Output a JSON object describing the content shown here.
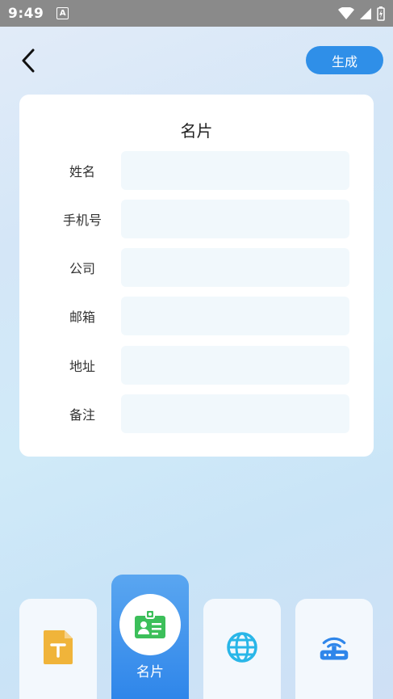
{
  "status": {
    "time": "9:49",
    "a_icon_letter": "A"
  },
  "header": {
    "generate_label": "生成"
  },
  "card": {
    "title": "名片",
    "fields": [
      {
        "label": "姓名",
        "value": "",
        "placeholder": ""
      },
      {
        "label": "手机号",
        "value": "",
        "placeholder": ""
      },
      {
        "label": "公司",
        "value": "",
        "placeholder": ""
      },
      {
        "label": "邮箱",
        "value": "",
        "placeholder": ""
      },
      {
        "label": "地址",
        "value": "",
        "placeholder": ""
      },
      {
        "label": "备注",
        "value": "",
        "placeholder": ""
      }
    ]
  },
  "tabs": [
    {
      "icon": "text-file-icon",
      "label": ""
    },
    {
      "icon": "business-card-icon",
      "label": "名片",
      "active": true
    },
    {
      "icon": "globe-icon",
      "label": ""
    },
    {
      "icon": "router-wifi-icon",
      "label": ""
    }
  ],
  "colors": {
    "accent": "#2f8fe8",
    "field_bg": "#f1f8fc",
    "card_green": "#3cbf5a",
    "globe": "#29b6e8",
    "file": "#f0b43a"
  }
}
